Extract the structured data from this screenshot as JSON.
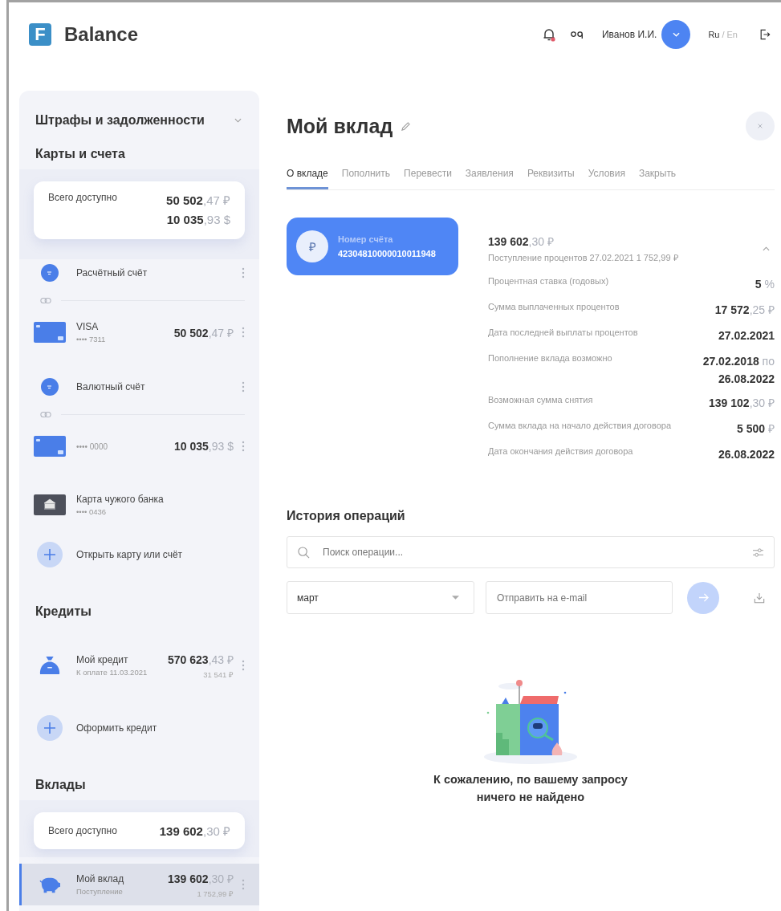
{
  "header": {
    "logo": {
      "letter": "F",
      "name": "Balance"
    },
    "notifications": {
      "unread": true
    },
    "user": {
      "name": "Иванов И.И."
    },
    "languages": [
      {
        "label": "Ru",
        "selected": true
      },
      {
        "label": "En",
        "selected": false
      }
    ],
    "language_separator": "/"
  },
  "sidebar": {
    "fines": {
      "title": "Штрафы и задолженности",
      "expanded": false
    },
    "sections": [
      {
        "title": "Карты и счета",
        "summary": {
          "label": "Всего доступно",
          "amounts": [
            "**50 502**,47 ₽",
            "**10 035**,93 $"
          ]
        },
        "items": [
          {
            "kind": "account",
            "name": "Расчётный счёт",
            "menu": true,
            "selected": false
          },
          {
            "kind": "link"
          },
          {
            "kind": "card",
            "name": "VISA",
            "number": "•••• 7311",
            "amount": "**50 502**,47 ₽",
            "menu": true,
            "selected": false
          },
          {
            "kind": "account",
            "name": "Валютный счёт",
            "menu": true,
            "selected": false
          },
          {
            "kind": "link"
          },
          {
            "kind": "card",
            "number": "•••• 0000",
            "amount": "**10 035**,93 $",
            "menu": true,
            "selected": false
          },
          {
            "kind": "other-card",
            "name": "Карта чужого банка",
            "number": "•••• 0436",
            "menu": false,
            "selected": false
          },
          {
            "kind": "add",
            "name": "Открыть карту или счёт"
          }
        ]
      },
      {
        "title": "Кредиты",
        "items": [
          {
            "kind": "credit",
            "name": "Мой кредит",
            "sub": "К оплате 11.03.2021",
            "amount": "**570 623**,43 ₽",
            "sub_amount": "31 541 ₽",
            "menu": true,
            "selected": false
          },
          {
            "kind": "add",
            "name": "Оформить кредит"
          }
        ]
      },
      {
        "title": "Вклады",
        "summary": {
          "label": "Всего доступно",
          "amounts": [
            "**139 602**,30 ₽"
          ]
        },
        "items": [
          {
            "kind": "deposit",
            "name": "Мой вклад",
            "sub": "Поступление",
            "amount": "**139 602**,30 ₽",
            "sub_amount": "1 752,99 ₽",
            "menu": true,
            "selected": true
          }
        ]
      }
    ]
  },
  "deposit": {
    "title": "Мой вклад",
    "tabs": [
      {
        "label": "О вкладе",
        "selected": true
      },
      {
        "label": "Пополнить",
        "selected": false
      },
      {
        "label": "Перевести",
        "selected": false
      },
      {
        "label": "Заявления",
        "selected": false
      },
      {
        "label": "Реквизиты",
        "selected": false
      },
      {
        "label": "Условия",
        "selected": false
      },
      {
        "label": "Закрыть",
        "selected": false
      }
    ],
    "account_card": {
      "currency": "₽",
      "label": "Номер счёта",
      "number": "42304810000010011948"
    },
    "details": {
      "amount": "**139 602**,30 ₽",
      "income": "Поступление процентов 27.02.2021 1 752,99 ₽",
      "expanded": true,
      "rows": [
        {
          "label": "Процентная ставка (годовых)",
          "value": "**5** %"
        },
        {
          "label": "Сумма выплаченных процентов",
          "value": "**17 572**,25 ₽"
        },
        {
          "label": "Дата последней выплаты процентов",
          "value": "**27.02.2021**"
        },
        {
          "label": "Пополнение вклада возможно",
          "value": "**27.02.2018** по **26.08.2022**"
        },
        {
          "label": "Возможная сумма снятия",
          "value": "**139 102**,30 ₽"
        },
        {
          "label": "Сумма вклада на начало действия договора",
          "value": "**5 500** ₽"
        },
        {
          "label": "Дата окончания действия договора",
          "value": "**26.08.2022**"
        }
      ]
    }
  },
  "history": {
    "title": "История операций",
    "search_placeholder": "Поиск операции...",
    "month": "март",
    "email_placeholder": "Отправить на e-mail",
    "send_disabled": true,
    "empty_message": "К сожалению, по вашему запросу ничего не найдено"
  }
}
